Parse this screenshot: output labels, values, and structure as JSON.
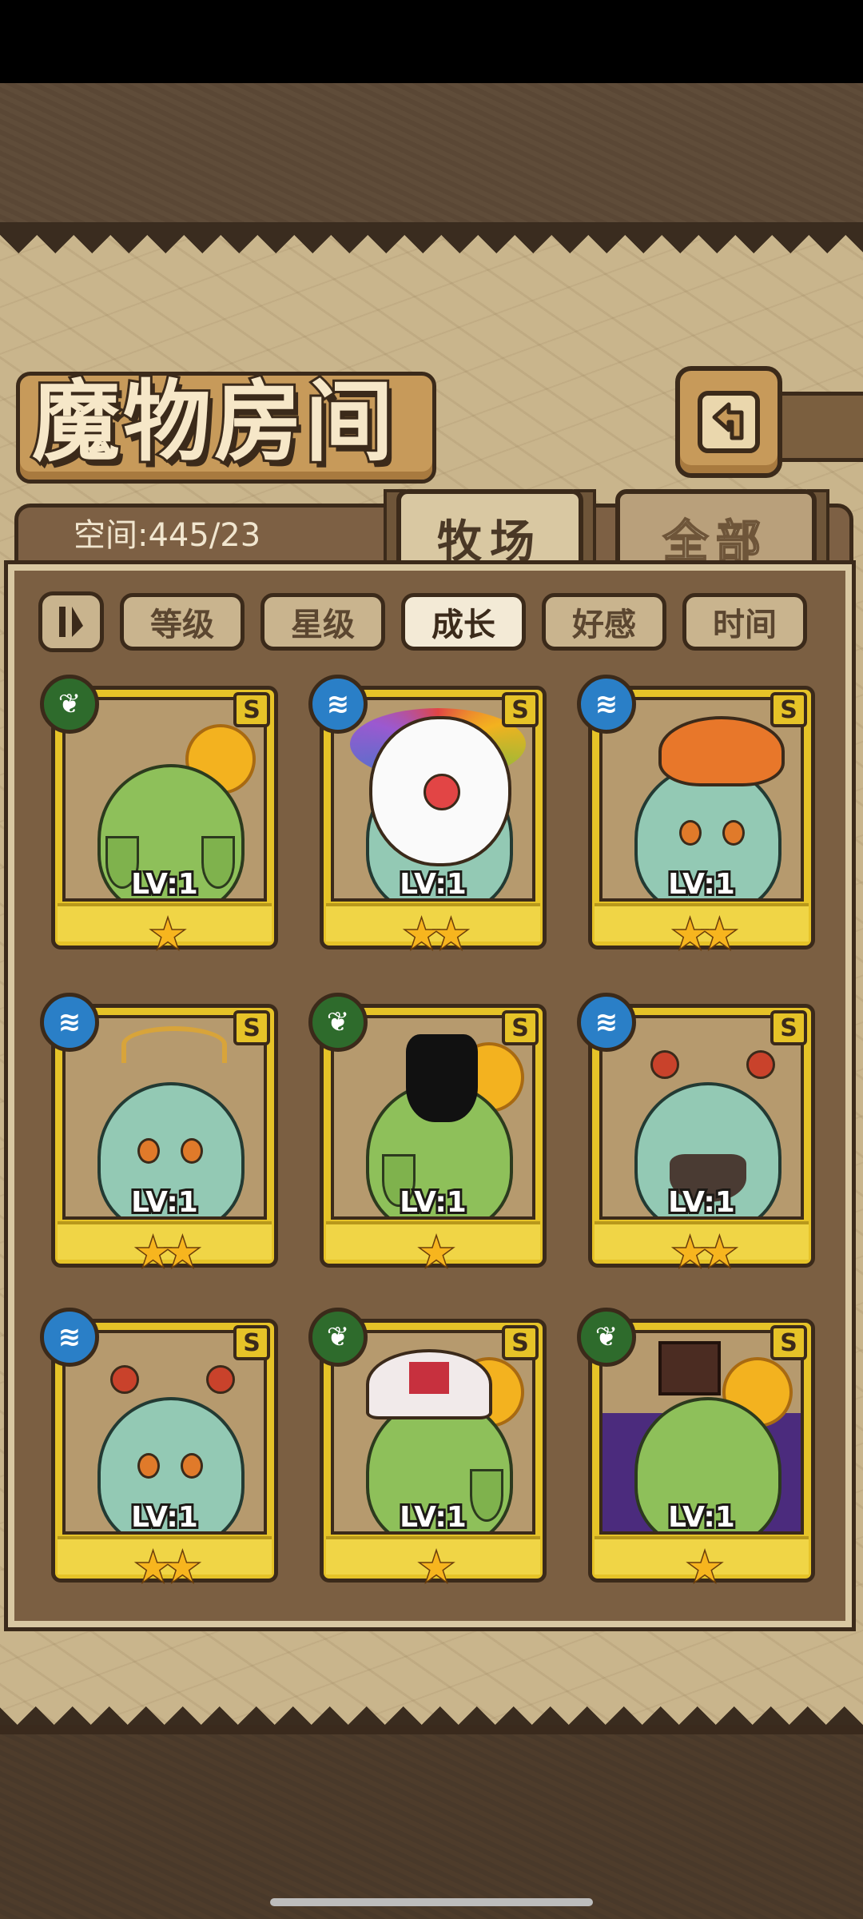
{
  "title": "魔物房间",
  "space_label": "空间:445/23",
  "tabs": [
    {
      "label": "牧场",
      "active": true
    },
    {
      "label": "全部",
      "active": false
    }
  ],
  "filters": [
    {
      "label": "等级",
      "active": false
    },
    {
      "label": "星级",
      "active": false
    },
    {
      "label": "成长",
      "active": true
    },
    {
      "label": "好感",
      "active": false
    },
    {
      "label": "时间",
      "active": false
    }
  ],
  "monsters": [
    {
      "element": "leaf-icon",
      "grade": "S",
      "level": "LV:1",
      "stars": "★",
      "star_count": 1
    },
    {
      "element": "water-icon",
      "grade": "S",
      "level": "LV:1",
      "stars": "★★",
      "star_count": 2
    },
    {
      "element": "water-icon",
      "grade": "S",
      "level": "LV:1",
      "stars": "★★",
      "star_count": 2
    },
    {
      "element": "water-icon",
      "grade": "S",
      "level": "LV:1",
      "stars": "★★",
      "star_count": 2
    },
    {
      "element": "leaf-icon",
      "grade": "S",
      "level": "LV:1",
      "stars": "★",
      "star_count": 1
    },
    {
      "element": "water-icon",
      "grade": "S",
      "level": "LV:1",
      "stars": "★★",
      "star_count": 2
    },
    {
      "element": "water-icon",
      "grade": "S",
      "level": "LV:1",
      "stars": "★★",
      "star_count": 2
    },
    {
      "element": "leaf-icon",
      "grade": "S",
      "level": "LV:1",
      "stars": "★",
      "star_count": 1
    },
    {
      "element": "leaf-icon",
      "grade": "S",
      "level": "LV:1",
      "stars": "★",
      "star_count": 1
    }
  ],
  "colors": {
    "leaf": "#2e6b2c",
    "water": "#2a7fc7",
    "card_gold": "#e6c328",
    "panel": "#c9b58c"
  }
}
